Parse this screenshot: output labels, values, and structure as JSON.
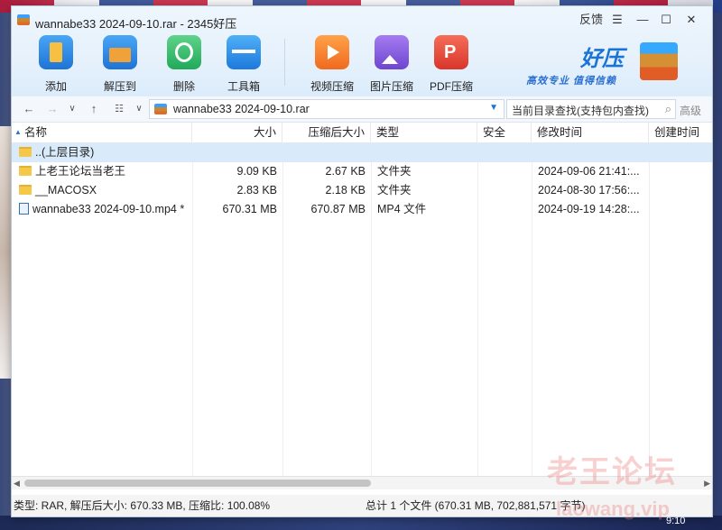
{
  "window": {
    "title": "wannabe33 2024-09-10.rar - 2345好压"
  },
  "title_controls": {
    "feedback": "反馈",
    "menu": "☰",
    "minimize": "—",
    "maximize": "☐",
    "close": "✕"
  },
  "toolbar": [
    {
      "label": "添加",
      "icon": "add-icon",
      "color": "#2f8de4"
    },
    {
      "label": "解压到",
      "icon": "extract-icon",
      "color": "#2f8de4"
    },
    {
      "label": "删除",
      "icon": "recycle-icon",
      "color": "#2fba6a"
    },
    {
      "label": "工具箱",
      "icon": "toolbox-icon",
      "color": "#2f8de4"
    },
    {
      "label": "视频压缩",
      "icon": "video-icon",
      "color": "#f07a2a"
    },
    {
      "label": "图片压缩",
      "icon": "image-icon",
      "color": "#8a5bd8"
    },
    {
      "label": "PDF压缩",
      "icon": "pdf-icon",
      "color": "#e24a3b"
    }
  ],
  "brand": {
    "name": "好压",
    "slogan": "高效专业 值得信赖"
  },
  "address": {
    "path": "wannabe33 2024-09-10.rar",
    "search_placeholder": "当前目录查找(支持包内查找)",
    "advanced": "高级"
  },
  "columns": [
    "名称",
    "大小",
    "压缩后大小",
    "类型",
    "安全",
    "修改时间",
    "创建时间"
  ],
  "files": [
    {
      "name": "..(上层目录)",
      "size": "",
      "packed": "",
      "type": "",
      "safe": "",
      "modified": "",
      "created": "",
      "kind": "folder"
    },
    {
      "name": "上老王论坛当老王",
      "size": "9.09 KB",
      "packed": "2.67 KB",
      "type": "文件夹",
      "safe": "",
      "modified": "2024-09-06 21:41:...",
      "created": "",
      "kind": "folder"
    },
    {
      "name": "__MACOSX",
      "size": "2.83 KB",
      "packed": "2.18 KB",
      "type": "文件夹",
      "safe": "",
      "modified": "2024-08-30 17:56:...",
      "created": "",
      "kind": "folder"
    },
    {
      "name": "wannabe33 2024-09-10.mp4 *",
      "size": "670.31 MB",
      "packed": "670.87 MB",
      "type": "MP4 文件",
      "safe": "",
      "modified": "2024-09-19 14:28:...",
      "created": "",
      "kind": "file"
    }
  ],
  "status": {
    "left": "类型: RAR, 解压后大小: 670.33 MB, 压缩比: 100.08%",
    "right": "总计 1 个文件 (670.31 MB, 702,881,571 字节)"
  },
  "watermark": {
    "line1": "老王论坛",
    "line2": "laowang.vip"
  },
  "clock": "9:10"
}
